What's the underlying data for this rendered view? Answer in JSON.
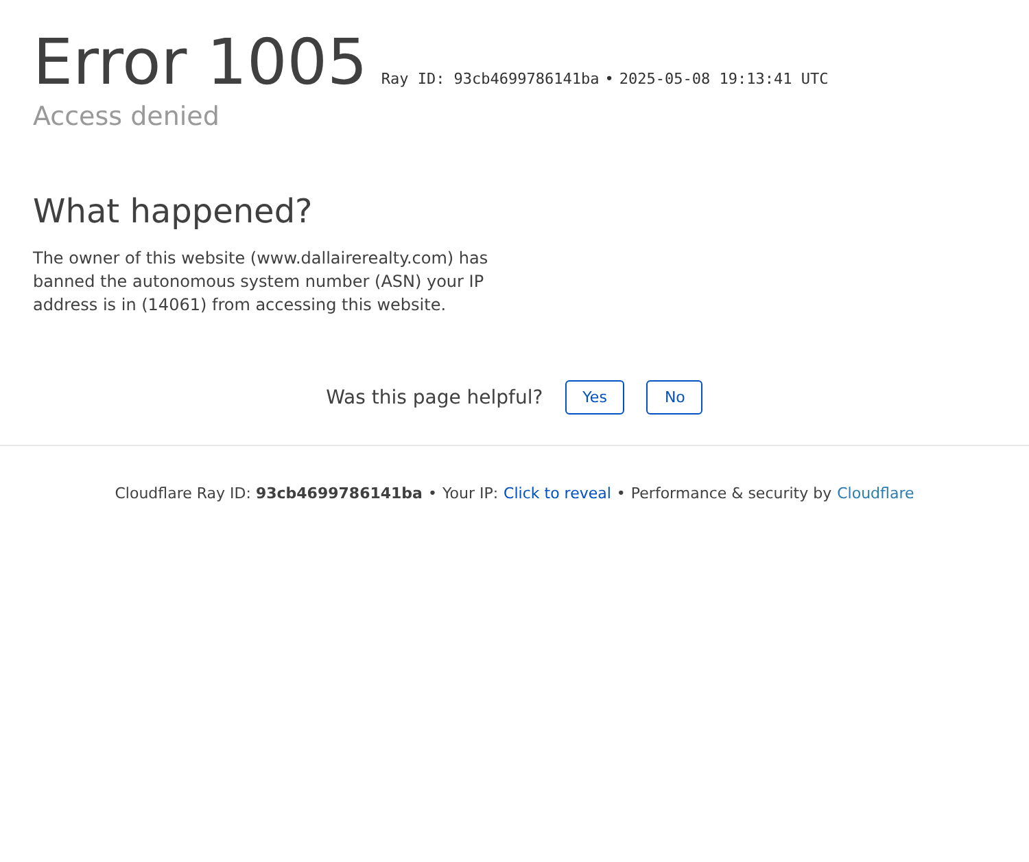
{
  "header": {
    "title": "Error 1005",
    "ray_id": "Ray ID: 93cb4699786141ba",
    "separator": "•",
    "timestamp": "2025-05-08 19:13:41 UTC",
    "subtitle": "Access denied"
  },
  "section": {
    "heading": "What happened?",
    "body": "The owner of this website (www.dallairerealty.com) has banned the autonomous system number (ASN) your IP address is in (14061) from accessing this website."
  },
  "feedback": {
    "question": "Was this page helpful?",
    "buttons": [
      "Yes",
      "No"
    ]
  },
  "footer": {
    "ray_label": "Cloudflare Ray ID: **93cb4699786141ba**",
    "separator_1": "•",
    "ip_label": "Your IP:",
    "ip_link": "Click to reveal",
    "separator_2": "•",
    "perf_label": "Performance & security by",
    "perf_link": "Cloudflare"
  }
}
